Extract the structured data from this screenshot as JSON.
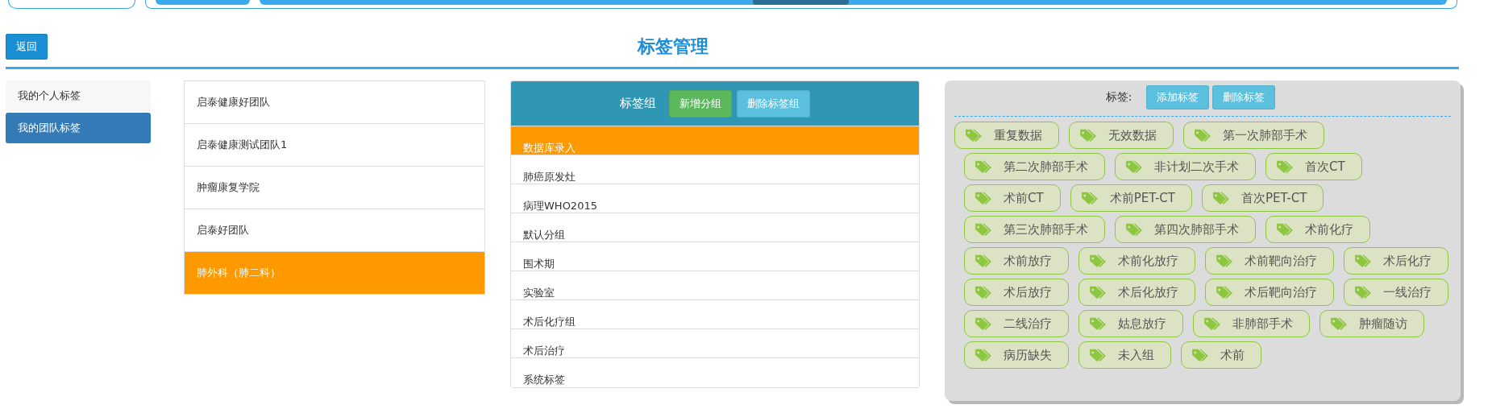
{
  "back_button": "返回",
  "title": "标签管理",
  "sidebar": [
    {
      "label": "我的个人标签",
      "selected": false
    },
    {
      "label": "我的团队标签",
      "selected": true
    }
  ],
  "teams": [
    {
      "label": "启泰健康好团队",
      "selected": false
    },
    {
      "label": "启泰健康测试团队1",
      "selected": false
    },
    {
      "label": "肿瘤康复学院",
      "selected": false
    },
    {
      "label": "启泰好团队",
      "selected": false
    },
    {
      "label": "肺外科（肺二科）",
      "selected": true
    }
  ],
  "group_panel": {
    "title": "标签组",
    "add_button": "新增分组",
    "delete_button": "删除标签组",
    "groups": [
      {
        "label": "数据库录入",
        "selected": true
      },
      {
        "label": "肺癌原发灶",
        "selected": false
      },
      {
        "label": "病理WHO2015",
        "selected": false
      },
      {
        "label": "默认分组",
        "selected": false
      },
      {
        "label": "围术期",
        "selected": false
      },
      {
        "label": "实验室",
        "selected": false
      },
      {
        "label": "术后化疗组",
        "selected": false
      },
      {
        "label": "术后治疗",
        "selected": false
      },
      {
        "label": "系统标签",
        "selected": false
      }
    ]
  },
  "tag_panel": {
    "title": "标签:",
    "add_button": "添加标签",
    "delete_button": "删除标签",
    "tag_rows": [
      [
        "重复数据",
        "无效数据",
        "第一次肺部手术"
      ],
      [
        "第二次肺部手术",
        "非计划二次手术",
        "首次CT"
      ],
      [
        "术前CT",
        "术前PET-CT",
        "首次PET-CT"
      ],
      [
        "第三次肺部手术",
        "第四次肺部手术",
        "术前化疗"
      ],
      [
        "术前放疗",
        "术前化放疗",
        "术前靶向治疗",
        "术后化疗"
      ],
      [
        "术后放疗",
        "术后化放疗",
        "术后靶向治疗",
        "一线治疗"
      ],
      [
        "二线治疗",
        "姑息放疗",
        "非肺部手术",
        "肿瘤随访"
      ],
      [
        "病历缺失",
        "未入组",
        "术前"
      ]
    ]
  }
}
